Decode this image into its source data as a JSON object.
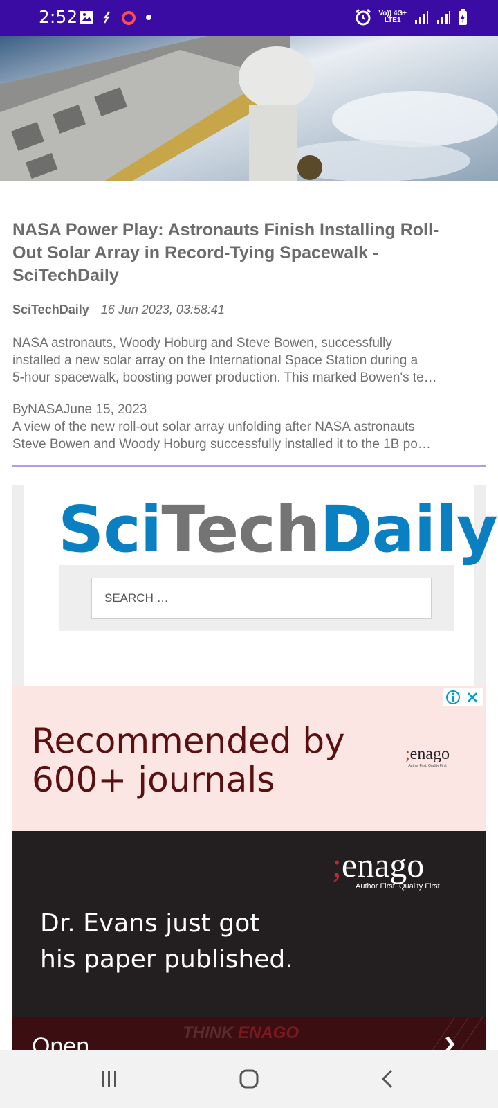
{
  "status_bar": {
    "time": "2:52",
    "network_top": "Vo)) 4G+",
    "network_bottom": "LTE1"
  },
  "article": {
    "title": "NASA Power Play: Astronauts Finish Installing Roll-Out Solar Array in Record-Tying Spacewalk - SciTechDaily",
    "source": "SciTechDaily",
    "date": "16 Jun 2023, 03:58:41",
    "summary_lines": [
      "NASA astronauts, Woody Hoburg and Steve Bowen, successfully",
      "installed a new solar array on the International Space Station during a",
      "5-hour spacewalk, boosting power production. This marked Bowen's te…"
    ],
    "excerpt_lines": [
      "ByNASAJune 15, 2023",
      "A view of the new roll-out solar array unfolding after NASA astronauts",
      "Steve Bowen and Woody Hoburg successfully installed it to the 1B po…"
    ]
  },
  "embed": {
    "logo_sci": "Sci",
    "logo_tech": "Tech",
    "logo_daily": "Daily",
    "search_placeholder": "SEARCH …"
  },
  "ad": {
    "headline_1": "Recommended by",
    "headline_2": "600+ journals",
    "brand": "enago",
    "tagline_small": "Author First, Quality First",
    "tagline": "Author First, Quality First",
    "body_1": "Dr. Evans just got",
    "body_2": "his paper published.",
    "think_1": "THINK ",
    "think_2": "ENAGO",
    "open_label": "Open"
  },
  "colors": {
    "status_bar": "#3a0ca3",
    "divider": "#b39ddb",
    "brand_blue": "#0a7fc1",
    "ad_pink": "#fbe6e4",
    "ad_dark": "#231f20"
  },
  "icons": [
    "image-icon",
    "sync-icon",
    "ring-icon",
    "dot-icon",
    "alarm-icon",
    "signal-icon",
    "battery-icon",
    "ad-info-icon",
    "ad-close-icon",
    "enago-mark-icon",
    "recent-apps-icon",
    "home-icon",
    "back-icon"
  ]
}
